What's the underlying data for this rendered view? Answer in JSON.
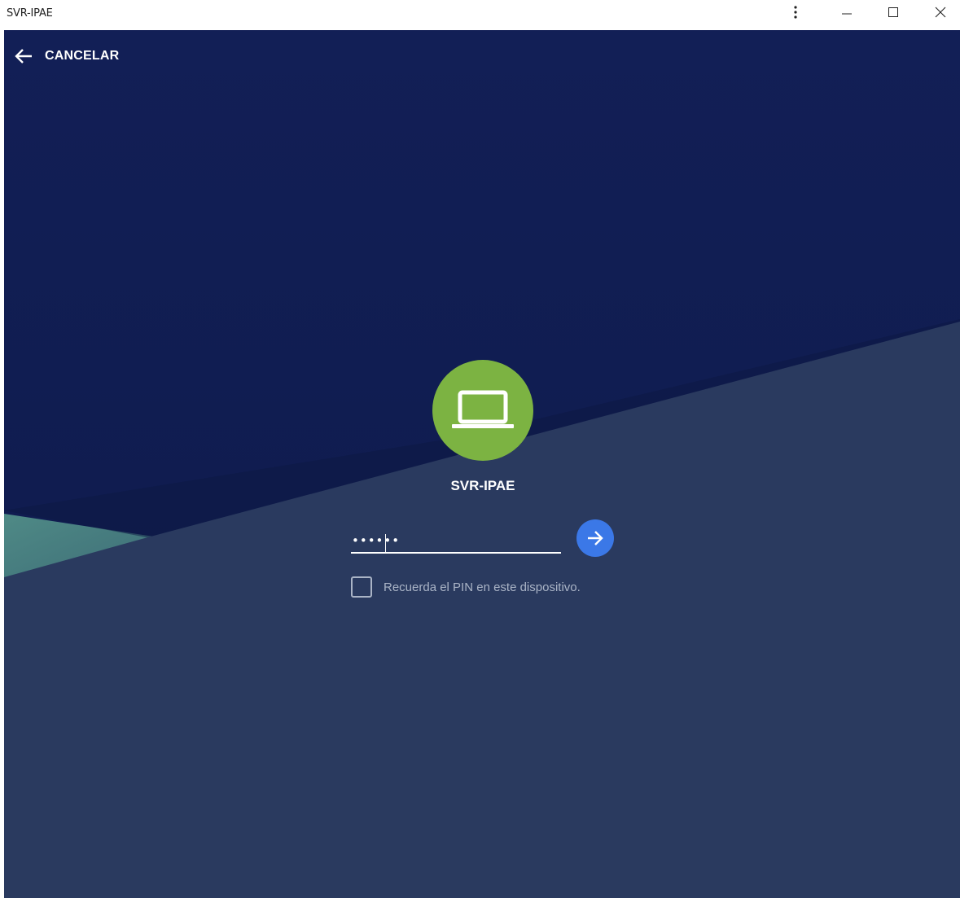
{
  "window": {
    "title": "SVR-IPAE",
    "controls": {
      "more_icon": "more-vert-icon",
      "minimize_icon": "minimize-icon",
      "maximize_icon": "maximize-icon",
      "close_icon": "close-icon"
    }
  },
  "header": {
    "cancel_label": "CANCELAR",
    "back_icon": "arrow-left-icon"
  },
  "login": {
    "host_icon": "laptop-icon",
    "hostname": "SVR-IPAE",
    "pin_value": "••••••",
    "submit_icon": "arrow-right-icon",
    "remember_label": "Recuerda el PIN en este dispositivo.",
    "remember_checked": false
  },
  "colors": {
    "background_top": "#101e55",
    "background_bottom": "#2a3a5f",
    "avatar": "#7cb342",
    "submit": "#3b78e7",
    "muted_text": "#aab4c6"
  }
}
